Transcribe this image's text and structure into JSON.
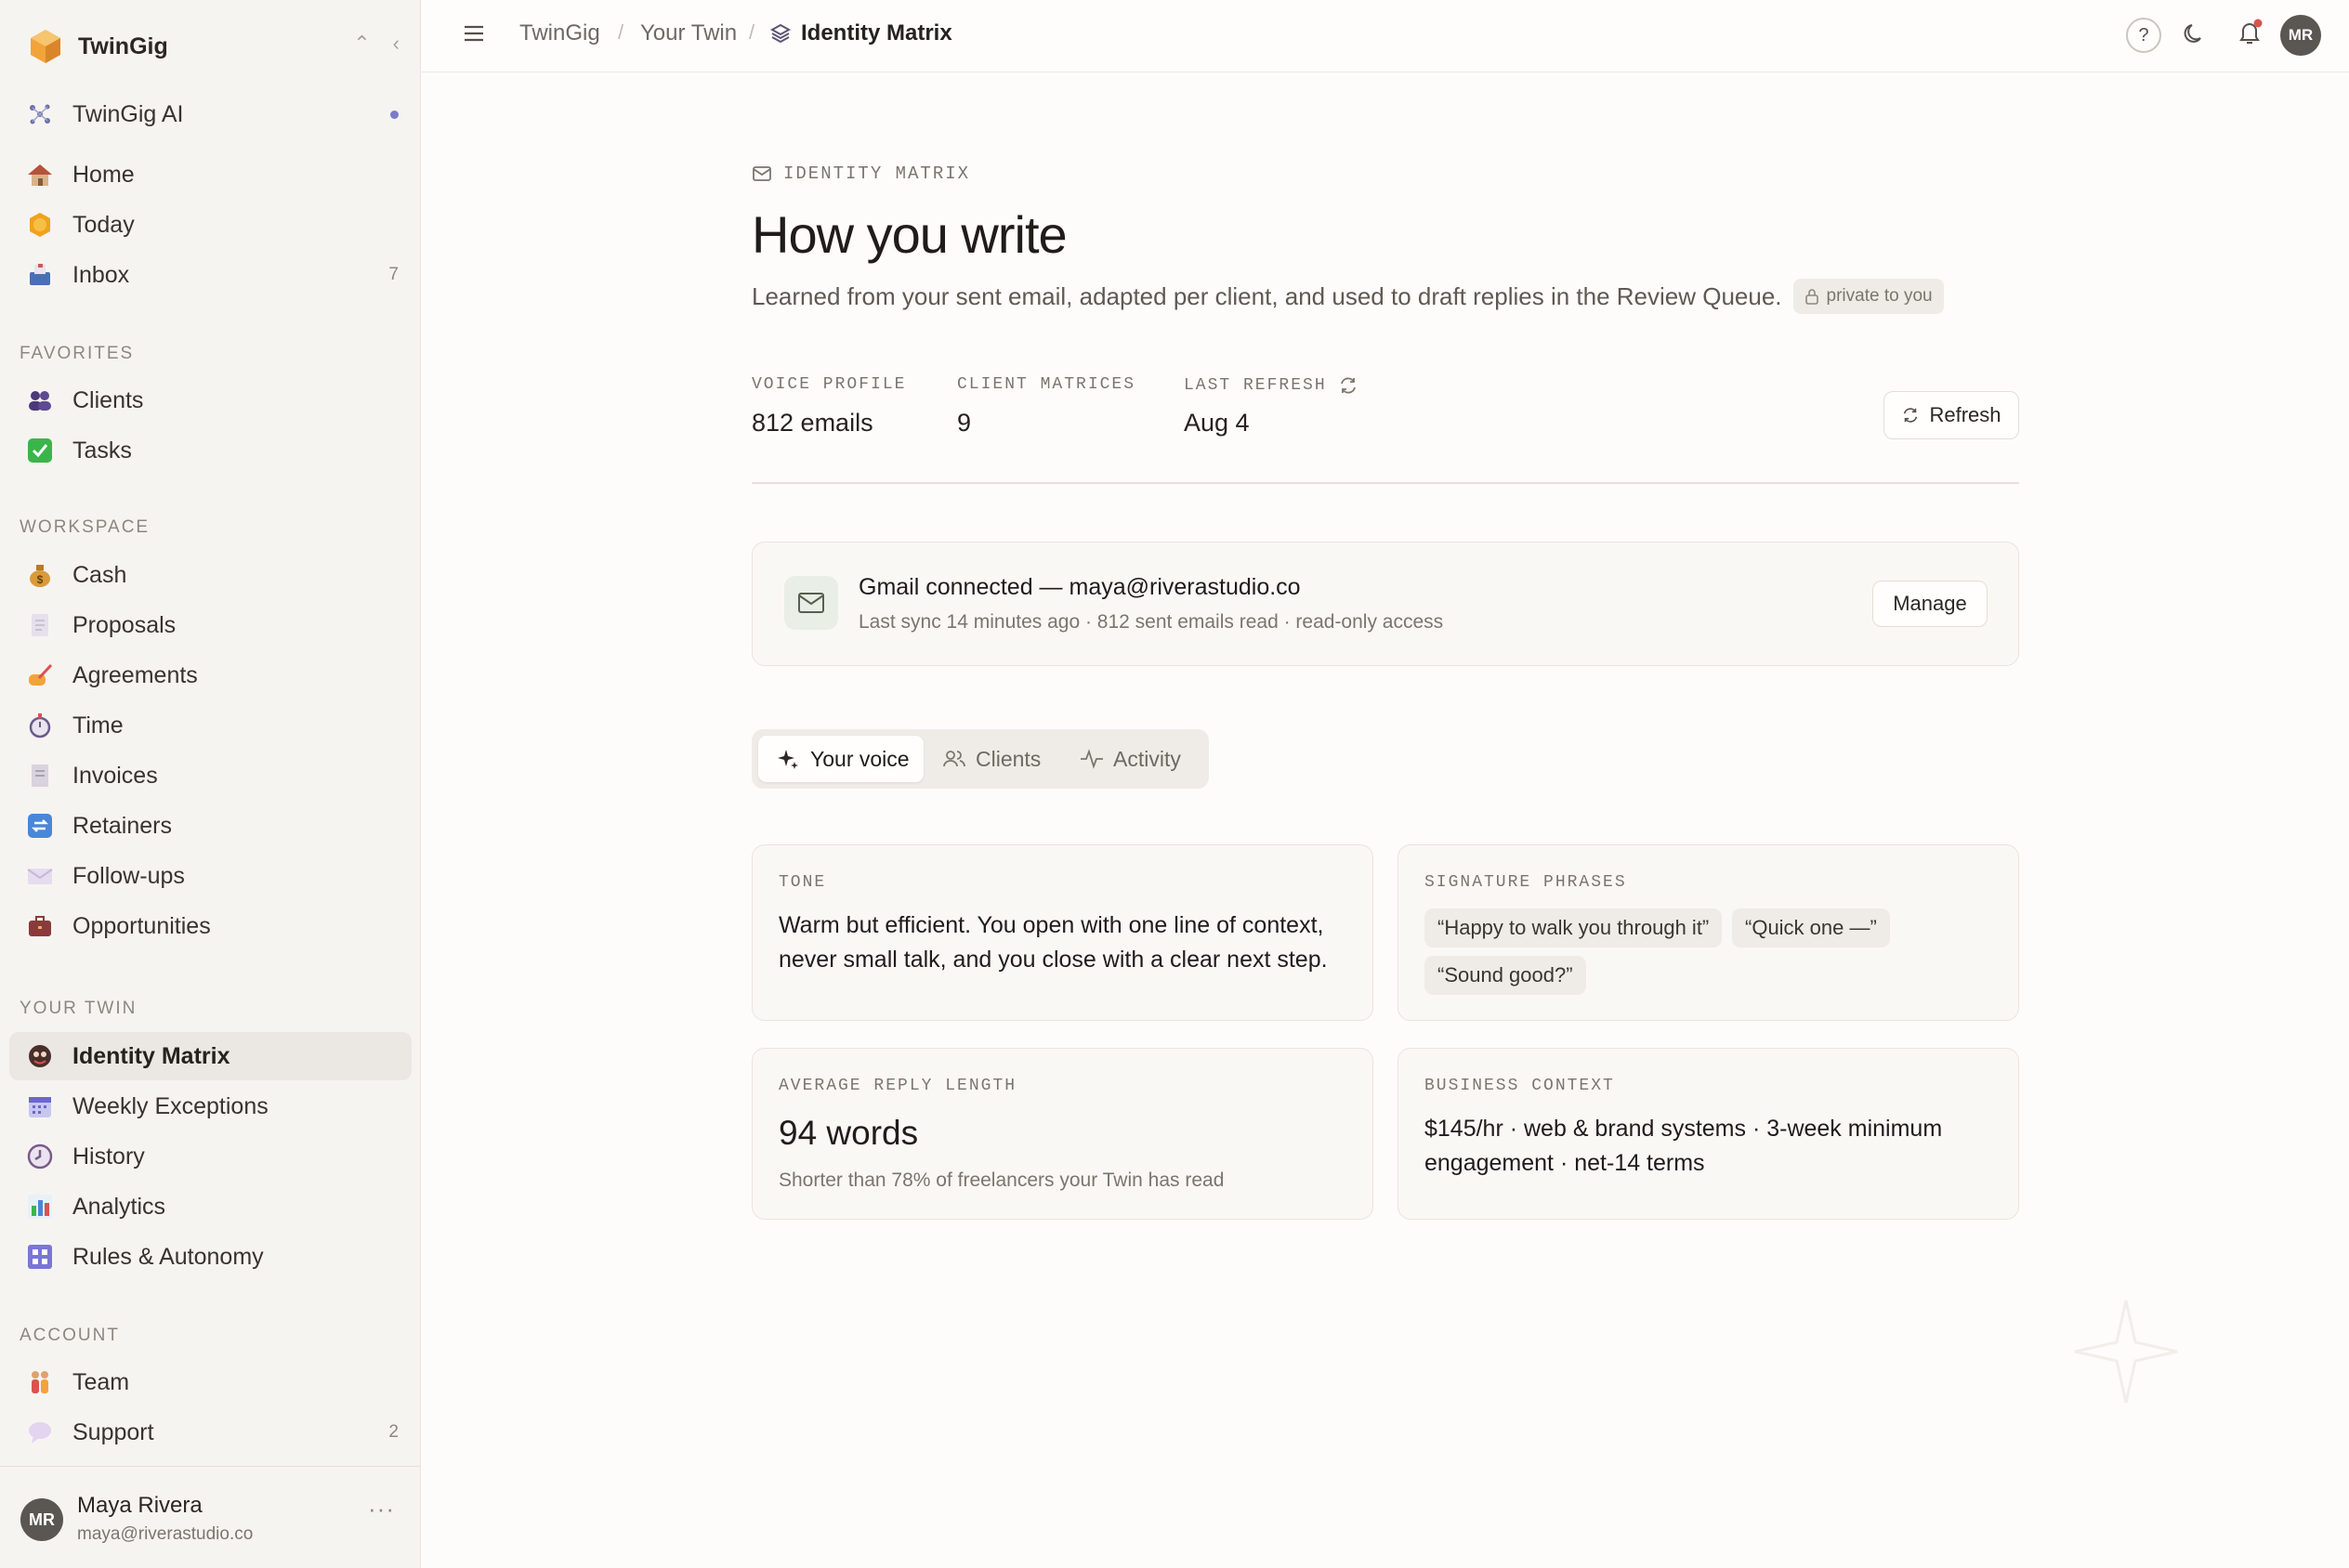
{
  "app": {
    "name": "TwinGig"
  },
  "sidebar": {
    "ai_label": "TwinGig AI",
    "main_items": [
      {
        "label": "Home",
        "icon": "house-icon"
      },
      {
        "label": "Today",
        "icon": "sun-icon"
      },
      {
        "label": "Inbox",
        "icon": "inbox-tray-icon",
        "count": "7"
      }
    ],
    "favorites": {
      "title": "FAVORITES",
      "items": [
        {
          "label": "Clients",
          "icon": "people-icon"
        },
        {
          "label": "Tasks",
          "icon": "check-box-icon"
        }
      ]
    },
    "workspace": {
      "title": "WORKSPACE",
      "items": [
        {
          "label": "Cash",
          "icon": "money-bag-icon"
        },
        {
          "label": "Proposals",
          "icon": "document-icon"
        },
        {
          "label": "Agreements",
          "icon": "writing-hand-icon"
        },
        {
          "label": "Time",
          "icon": "stopwatch-icon"
        },
        {
          "label": "Invoices",
          "icon": "receipt-icon"
        },
        {
          "label": "Retainers",
          "icon": "repeat-icon"
        },
        {
          "label": "Follow-ups",
          "icon": "envelope-icon"
        },
        {
          "label": "Opportunities",
          "icon": "briefcase-icon"
        }
      ]
    },
    "twin": {
      "title": "YOUR TWIN",
      "items": [
        {
          "label": "Identity Matrix",
          "icon": "mask-icon",
          "active": true
        },
        {
          "label": "Weekly Exceptions",
          "icon": "calendar-icon"
        },
        {
          "label": "History",
          "icon": "clock-icon"
        },
        {
          "label": "Analytics",
          "icon": "bar-chart-icon"
        },
        {
          "label": "Rules & Autonomy",
          "icon": "grid-icon"
        }
      ]
    },
    "account": {
      "title": "ACCOUNT",
      "items": [
        {
          "label": "Team",
          "icon": "people-pair-icon"
        },
        {
          "label": "Support",
          "icon": "speech-bubble-icon",
          "count": "2"
        }
      ]
    },
    "user": {
      "initials": "MR",
      "name": "Maya Rivera",
      "email": "maya@riverastudio.co"
    }
  },
  "topbar": {
    "breadcrumbs": [
      "TwinGig",
      "Your Twin",
      "Identity Matrix"
    ],
    "help_label": "?",
    "avatar_initials": "MR"
  },
  "header": {
    "eyebrow": "IDENTITY MATRIX",
    "title": "How you write",
    "description": "Learned from your sent email, adapted per client, and used to draft replies in the Review Queue.",
    "privacy_badge": "private to you"
  },
  "stats": [
    {
      "label": "VOICE PROFILE",
      "value": "812 emails"
    },
    {
      "label": "CLIENT MATRICES",
      "value": "9"
    },
    {
      "label": "LAST REFRESH",
      "value": "Aug 4"
    }
  ],
  "refresh_button": "Refresh",
  "connection": {
    "title": "Gmail connected — maya@riverastudio.co",
    "subtitle": "Last sync 14 minutes ago · 812 sent emails read · read-only access",
    "manage_label": "Manage"
  },
  "tabs": [
    {
      "label": "Your voice",
      "icon": "sparkle-icon",
      "active": true
    },
    {
      "label": "Clients",
      "icon": "users-icon"
    },
    {
      "label": "Activity",
      "icon": "activity-icon"
    }
  ],
  "cards": {
    "tone": {
      "label": "TONE",
      "text": "Warm but efficient. You open with one line of context, never small talk, and you close with a clear next step."
    },
    "phrases": {
      "label": "SIGNATURE PHRASES",
      "items": [
        "“Happy to walk you through it”",
        "“Quick one —”",
        "“Sound good?”"
      ]
    },
    "reply_length": {
      "label": "AVERAGE REPLY LENGTH",
      "value": "94 words",
      "note": "Shorter than 78% of freelancers your Twin has read"
    },
    "business": {
      "label": "BUSINESS CONTEXT",
      "text": "$145/hr · web & brand systems · 3-week minimum engagement · net-14 terms"
    }
  },
  "colors": {
    "accent": "#f2a33a",
    "notification_dot": "#d9534f",
    "ai_dot": "#7b7bc9"
  }
}
